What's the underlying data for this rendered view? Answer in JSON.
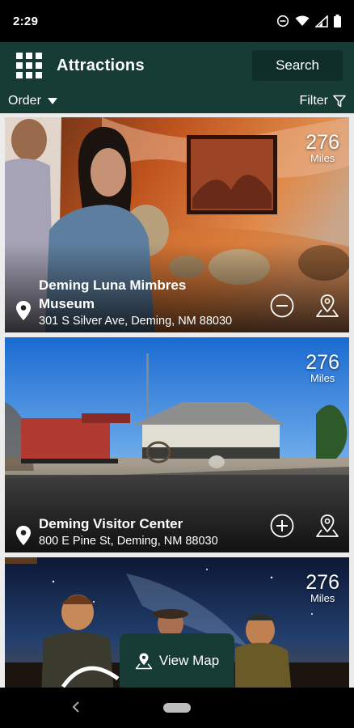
{
  "status_bar": {
    "time": "2:29"
  },
  "header": {
    "title": "Attractions",
    "search_label": "Search"
  },
  "toolbar": {
    "order_label": "Order",
    "filter_label": "Filter"
  },
  "attractions": [
    {
      "distance": "276",
      "unit": "Miles",
      "name": "Deming Luna Mimbres Museum",
      "address": "301 S Silver Ave, Deming, NM 88030",
      "action_icon": "minus-circle-icon"
    },
    {
      "distance": "276",
      "unit": "Miles",
      "name": "Deming Visitor Center",
      "address": "800 E Pine St, Deming, NM 88030",
      "action_icon": "plus-circle-icon"
    },
    {
      "distance": "276",
      "unit": "Miles"
    }
  ],
  "view_map": {
    "label": "View Map"
  },
  "colors": {
    "primary": "#173b35",
    "search_bg": "#102e29",
    "list_bg": "#ececec"
  }
}
